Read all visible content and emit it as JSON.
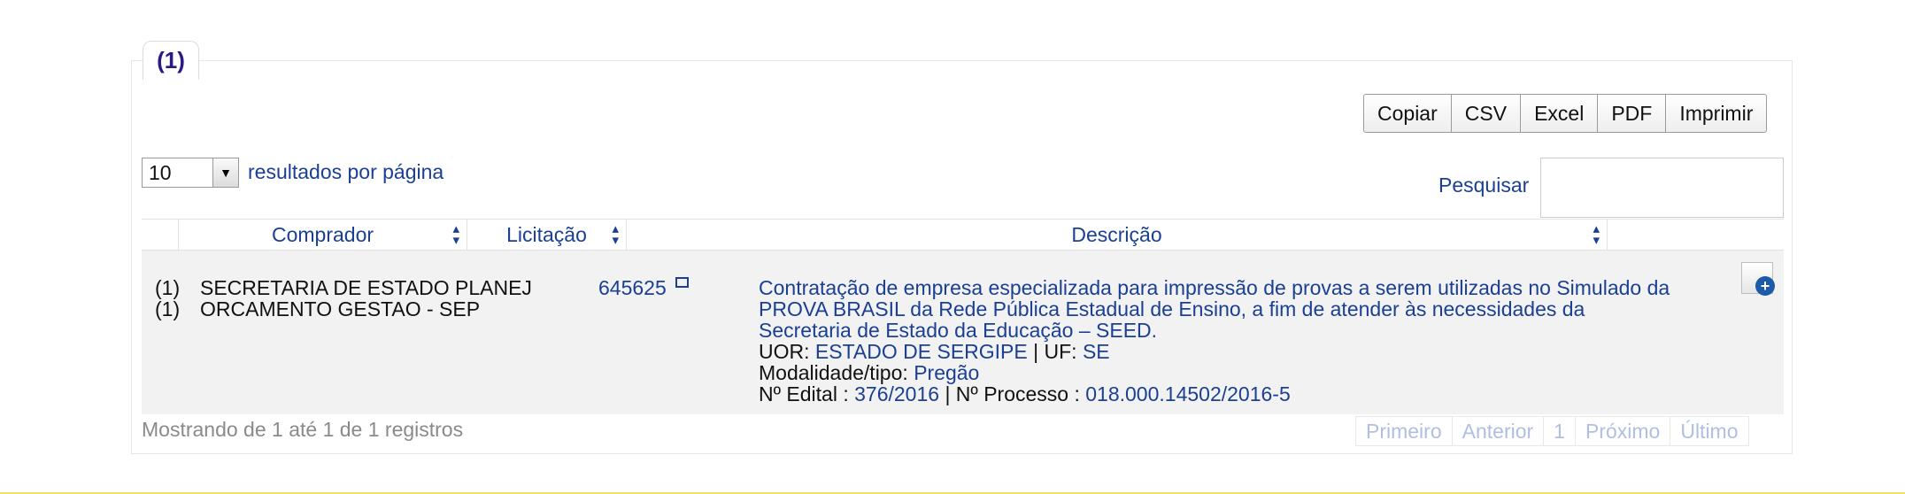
{
  "tab": {
    "label": "(1)"
  },
  "buttons": {
    "copy": "Copiar",
    "csv": "CSV",
    "excel": "Excel",
    "pdf": "PDF",
    "print": "Imprimir"
  },
  "length": {
    "value": "10",
    "label": "resultados por página"
  },
  "search": {
    "label": "Pesquisar",
    "value": ""
  },
  "columns": {
    "comprador": "Comprador",
    "licitacao": "Licitação",
    "descricao": "Descrição"
  },
  "row": {
    "index1": "(1)",
    "index2": "(1)",
    "comprador_line1": "SECRETARIA DE ESTADO PLANEJ",
    "comprador_line2": "ORCAMENTO GESTAO - SEP",
    "licitacao": "645625",
    "descricao_line1": "Contratação de empresa especializada para impressão de provas a serem utilizadas no Simulado da",
    "descricao_line2": "PROVA BRASIL da Rede Pública Estadual de Ensino, a fim de atender às necessidades da",
    "descricao_line3": "Secretaria de Estado da Educação – SEED.",
    "uor_label": "UOR:",
    "uor_value": "ESTADO DE SERGIPE",
    "uf_label": "| UF:",
    "uf_value": "SE",
    "modalidade_label": "Modalidade/tipo:",
    "modalidade_value": "Pregão",
    "edital_label": "Nº Edital :",
    "edital_value": "376/2016",
    "processo_label": "| Nº Processo :",
    "processo_value": "018.000.14502/2016-5"
  },
  "info": "Mostrando de 1 até 1 de 1 registros",
  "pagination": {
    "first": "Primeiro",
    "prev": "Anterior",
    "page": "1",
    "next": "Próximo",
    "last": "Último"
  },
  "colors": {
    "link": "#1a3f93",
    "tab_text": "#2a1a86",
    "disabled": "#b0bfe0"
  }
}
